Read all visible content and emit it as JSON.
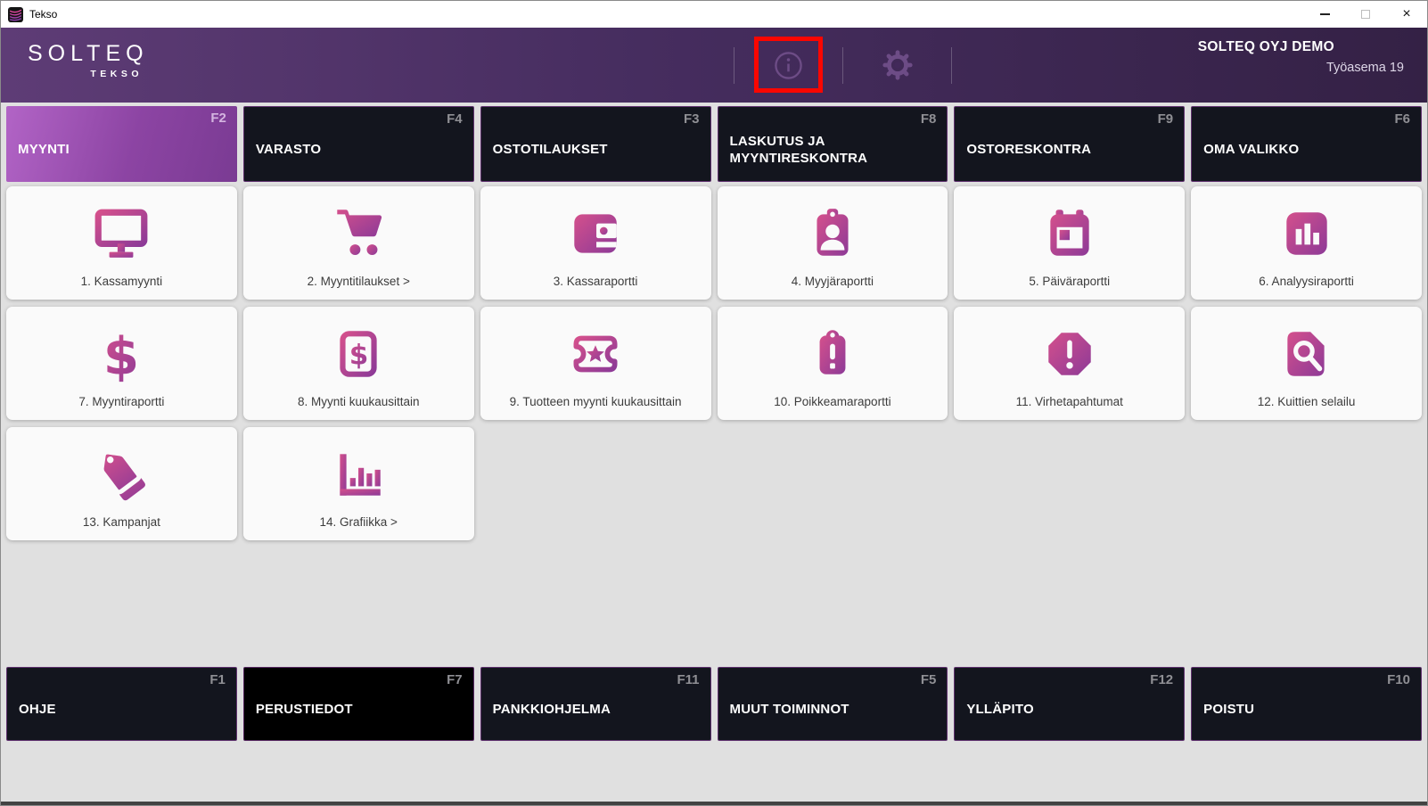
{
  "window": {
    "title": "Tekso",
    "controls": {
      "minimize": "minimize",
      "maximize": "maximize",
      "close_glyph": "×"
    }
  },
  "header": {
    "logo_main": "SOLTEQ",
    "logo_sub": "TEKSO",
    "company": "SOLTEQ OYJ DEMO",
    "workstation": "Työasema 19",
    "icons": [
      {
        "name": "info-icon"
      },
      {
        "name": "settings-gear-icon"
      }
    ]
  },
  "annotation": {
    "type": "highlight-box",
    "color": "#fb0600",
    "target": "info-icon"
  },
  "colors": {
    "header_gradient": [
      "#5e3c76",
      "#342145"
    ],
    "active_tab_gradient": [
      "#b264c6",
      "#7a3b93"
    ],
    "icon_gradient": [
      "#d4508c",
      "#8d3a97"
    ],
    "dark_button": "#13151e",
    "background": "#e0e0e0",
    "tile_background": "#fafafa"
  },
  "tabs": [
    {
      "label": "MYYNTI",
      "fkey": "F2",
      "active": true
    },
    {
      "label": "VARASTO",
      "fkey": "F4",
      "active": false
    },
    {
      "label": "OSTOTILAUKSET",
      "fkey": "F3",
      "active": false
    },
    {
      "label": "LASKUTUS JA MYYNTIRESKONTRA",
      "fkey": "F8",
      "active": false
    },
    {
      "label": "OSTORESKONTRA",
      "fkey": "F9",
      "active": false
    },
    {
      "label": "OMA VALIKKO",
      "fkey": "F6",
      "active": false
    }
  ],
  "tiles": [
    {
      "label": "1. Kassamyynti",
      "icon": "monitor-icon"
    },
    {
      "label": "2. Myyntitilaukset >",
      "icon": "shopping-cart-icon"
    },
    {
      "label": "3. Kassaraportti",
      "icon": "wallet-icon"
    },
    {
      "label": "4. Myyjäraportti",
      "icon": "id-badge-icon"
    },
    {
      "label": "5. Päiväraportti",
      "icon": "calendar-icon"
    },
    {
      "label": "6. Analyysiraportti",
      "icon": "bar-chart-icon"
    },
    {
      "label": "7. Myyntiraportti",
      "icon": "dollar-icon"
    },
    {
      "label": "8. Myynti kuukausittain",
      "icon": "money-bill-icon"
    },
    {
      "label": "9. Tuotteen myynti kuukausittain",
      "icon": "ticket-star-icon"
    },
    {
      "label": "10. Poikkeamaraportti",
      "icon": "alert-badge-icon"
    },
    {
      "label": "11. Virhetapahtumat",
      "icon": "alert-octagon-icon"
    },
    {
      "label": "12. Kuittien selailu",
      "icon": "receipt-search-icon"
    },
    {
      "label": "13. Kampanjat",
      "icon": "tags-icon"
    },
    {
      "label": "14. Grafiikka >",
      "icon": "graph-axis-icon"
    }
  ],
  "bottom_buttons": [
    {
      "label": "OHJE",
      "fkey": "F1",
      "pressed": false
    },
    {
      "label": "PERUSTIEDOT",
      "fkey": "F7",
      "pressed": true
    },
    {
      "label": "PANKKIOHJELMA",
      "fkey": "F11",
      "pressed": false
    },
    {
      "label": "MUUT TOIMINNOT",
      "fkey": "F5",
      "pressed": false
    },
    {
      "label": "YLLÄPITO",
      "fkey": "F12",
      "pressed": false
    },
    {
      "label": "POISTU",
      "fkey": "F10",
      "pressed": false
    }
  ]
}
